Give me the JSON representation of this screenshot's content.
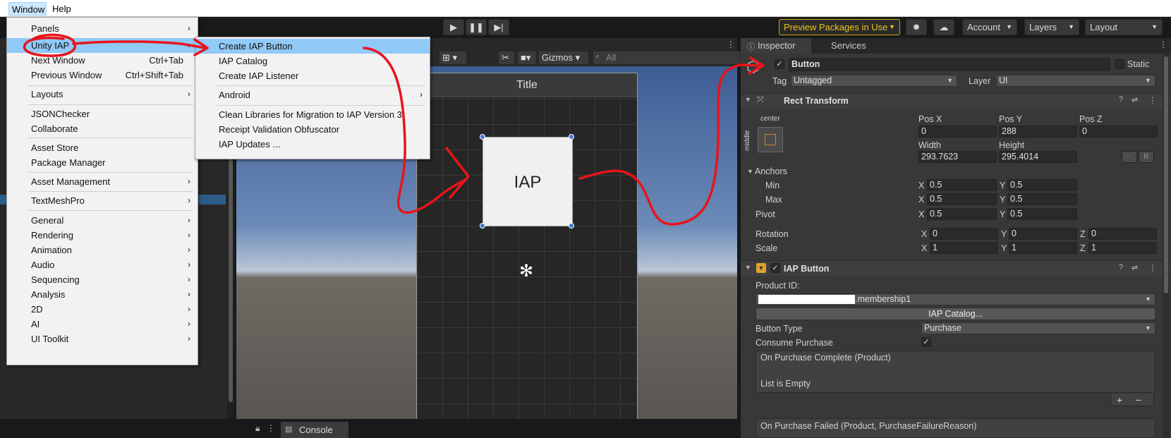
{
  "menubar": {
    "window": "Window",
    "help": "Help"
  },
  "toolbar": {
    "preview_packages": "Preview Packages in Use",
    "account": "Account",
    "layers": "Layers",
    "layout": "Layout"
  },
  "scene": {
    "gizmos": "Gizmos",
    "search_placeholder": "All",
    "game_title": "Title",
    "iap_button_text": "IAP"
  },
  "bottom": {
    "console": "Console"
  },
  "window_menu": [
    {
      "label": "Panels",
      "arrow": "›"
    },
    {
      "label": "Unity IAP",
      "arrow": "›",
      "highlight": true
    },
    {
      "label": "Next Window",
      "shortcut": "Ctrl+Tab"
    },
    {
      "label": "Previous Window",
      "shortcut": "Ctrl+Shift+Tab"
    },
    {
      "label": "Layouts",
      "arrow": "›"
    },
    {
      "label": "JSONChecker"
    },
    {
      "label": "Collaborate"
    },
    {
      "label": "Asset Store"
    },
    {
      "label": "Package Manager"
    },
    {
      "label": "Asset Management",
      "arrow": "›"
    },
    {
      "label": "TextMeshPro",
      "arrow": "›"
    },
    {
      "label": "General",
      "arrow": "›"
    },
    {
      "label": "Rendering",
      "arrow": "›"
    },
    {
      "label": "Animation",
      "arrow": "›"
    },
    {
      "label": "Audio",
      "arrow": "›"
    },
    {
      "label": "Sequencing",
      "arrow": "›"
    },
    {
      "label": "Analysis",
      "arrow": "›"
    },
    {
      "label": "2D",
      "arrow": "›"
    },
    {
      "label": "AI",
      "arrow": "›"
    },
    {
      "label": "UI Toolkit",
      "arrow": "›"
    }
  ],
  "iap_menu": [
    {
      "label": "Create IAP Button",
      "highlight": true
    },
    {
      "label": "IAP Catalog"
    },
    {
      "label": "Create IAP Listener"
    },
    {
      "label": "Android",
      "arrow": "›"
    },
    {
      "label": "Clean Libraries for Migration to IAP Version 3"
    },
    {
      "label": "Receipt Validation Obfuscator"
    },
    {
      "label": "IAP Updates ..."
    }
  ],
  "inspector": {
    "tab_inspector": "Inspector",
    "tab_services": "Services",
    "object_name": "Button",
    "static_label": "Static",
    "tag_label": "Tag",
    "tag_value": "Untagged",
    "layer_label": "Layer",
    "layer_value": "UI",
    "rect_transform": {
      "title": "Rect Transform",
      "anchor_h": "center",
      "anchor_v": "middle",
      "pos_x_label": "Pos X",
      "pos_x": "0",
      "pos_y_label": "Pos Y",
      "pos_y": "288",
      "pos_z_label": "Pos Z",
      "pos_z": "0",
      "width_label": "Width",
      "width": "293.7623",
      "height_label": "Height",
      "height": "295.4014",
      "r_button": "R",
      "anchors_label": "Anchors",
      "min_label": "Min",
      "min_x": "0.5",
      "min_y": "0.5",
      "max_label": "Max",
      "max_x": "0.5",
      "max_y": "0.5",
      "pivot_label": "Pivot",
      "pivot_x": "0.5",
      "pivot_y": "0.5",
      "rotation_label": "Rotation",
      "rot_x": "0",
      "rot_y": "0",
      "rot_z": "0",
      "scale_label": "Scale",
      "scale_x": "1",
      "scale_y": "1",
      "scale_z": "1",
      "x": "X",
      "y": "Y",
      "z": "Z"
    },
    "iap_button": {
      "title": "IAP Button",
      "product_id_label": "Product ID:",
      "product_id_value": ".membership1",
      "catalog_button": "IAP Catalog...",
      "button_type_label": "Button Type",
      "button_type_value": "Purchase",
      "consume_label": "Consume Purchase",
      "on_complete": "On Purchase Complete (Product)",
      "list_empty": "List is Empty",
      "on_failed": "On Purchase Failed (Product, PurchaseFailureReason)"
    }
  },
  "colors": {
    "annotation": "#e8141b",
    "menu_highlight": "#91c9f7",
    "preview_warning": "#f0c419"
  }
}
